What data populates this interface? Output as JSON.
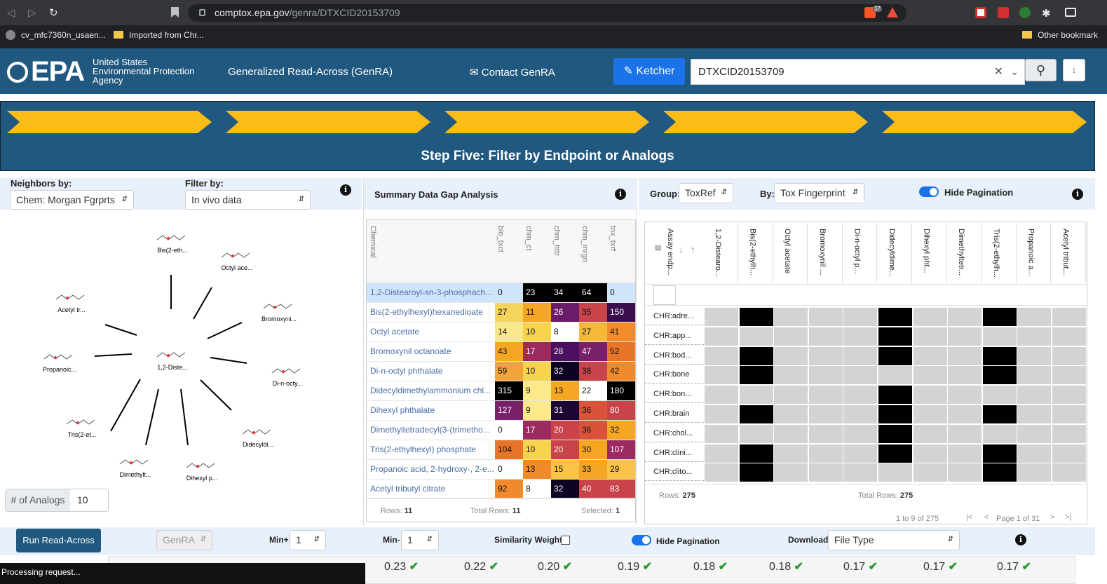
{
  "browser": {
    "url_host": "comptox.epa.gov",
    "url_path": "/genra/DTXCID20153709",
    "bookmarks": [
      "cv_mfc7360n_usaen...",
      "Imported from Chr...",
      "Other bookmark"
    ],
    "ext_badge": "37"
  },
  "header": {
    "logo": "EPA",
    "agency_line1": "United States",
    "agency_line2": "Environmental Protection",
    "agency_line3": "Agency",
    "app_title": "Generalized Read-Across (GenRA)",
    "contact": "Contact GenRA",
    "ketcher": "Ketcher",
    "search_value": "DTXCID20153709"
  },
  "steps": {
    "title": "Step Five: Filter by Endpoint or Analogs"
  },
  "left": {
    "neighbors_label": "Neighbors by:",
    "neighbors_value": "Chem: Morgan Fgrprts",
    "filter_label": "Filter by:",
    "filter_value": "In vivo data",
    "analogs_label": "# of Analogs",
    "analogs_value": "10",
    "center_label": "1,2-Diste...",
    "nodes": [
      "Bis(2-eth...",
      "Octyl ace...",
      "Bromoxyni...",
      "Di-n-octy...",
      "Didecyldi...",
      "Dihexyl p...",
      "Dimethylt...",
      "Tris(2-et...",
      "Propanoic...",
      "Acetyl tr..."
    ]
  },
  "middle": {
    "title": "Summary Data Gap Analysis",
    "col_chemical": "Chemical",
    "columns": [
      "bio_txct",
      "chm_ct",
      "chm_httr",
      "chm_mrgn",
      "tox_txrf"
    ],
    "rows": [
      {
        "name": "1,2-Distearoyl-sn-3-phosphach...",
        "vals": [
          "0",
          "23",
          "34",
          "64",
          "0"
        ],
        "colors": [
          "#cfe5fb",
          "#000000",
          "#000000",
          "#000000",
          "#cfe5fb"
        ],
        "light": [
          false,
          true,
          true,
          true,
          false
        ]
      },
      {
        "name": "Bis(2-ethylhexyl)hexanedioate",
        "vals": [
          "27",
          "11",
          "26",
          "35",
          "150"
        ],
        "colors": [
          "#f6d35a",
          "#f5a623",
          "#6a1b6a",
          "#c9434a",
          "#3a0d4d"
        ],
        "light": [
          false,
          false,
          true,
          false,
          true
        ]
      },
      {
        "name": "Octyl acetate",
        "vals": [
          "14",
          "10",
          "8",
          "27",
          "41"
        ],
        "colors": [
          "#f9e98a",
          "#f7d44e",
          "#ffffff",
          "#f5b93a",
          "#f28c2a"
        ],
        "light": [
          false,
          false,
          false,
          false,
          false
        ]
      },
      {
        "name": "Bromoxynil octanoate",
        "vals": [
          "43",
          "17",
          "28",
          "47",
          "52"
        ],
        "colors": [
          "#f5a623",
          "#9c2a5e",
          "#4b1060",
          "#7a1f6a",
          "#e8742a"
        ],
        "light": [
          false,
          true,
          true,
          true,
          false
        ]
      },
      {
        "name": "Di-n-octyl phthalate",
        "vals": [
          "59",
          "10",
          "32",
          "38",
          "42"
        ],
        "colors": [
          "#f2a33a",
          "#f7d44e",
          "#0d0221",
          "#c9434a",
          "#f08a2a"
        ],
        "light": [
          false,
          false,
          true,
          false,
          false
        ]
      },
      {
        "name": "Didecyldimethylammonium chl...",
        "vals": [
          "315",
          "9",
          "13",
          "22",
          "180"
        ],
        "colors": [
          "#000000",
          "#fbe98a",
          "#f5a623",
          "#ffffff",
          "#000000"
        ],
        "light": [
          true,
          false,
          false,
          false,
          true
        ]
      },
      {
        "name": "Dihexyl phthalate",
        "vals": [
          "127",
          "9",
          "31",
          "36",
          "80"
        ],
        "colors": [
          "#7a1f6a",
          "#fbe98a",
          "#1a0533",
          "#d9533a",
          "#c9434a"
        ],
        "light": [
          true,
          false,
          true,
          false,
          true
        ]
      },
      {
        "name": "Dimethyltetradecyl(3-(trimetho...",
        "vals": [
          "0",
          "17",
          "20",
          "36",
          "32"
        ],
        "colors": [
          "#ffffff",
          "#9c2a5e",
          "#c9434a",
          "#d9533a",
          "#f5a623"
        ],
        "light": [
          false,
          true,
          true,
          false,
          false
        ]
      },
      {
        "name": "Tris(2-ethylhexyl) phosphate",
        "vals": [
          "104",
          "10",
          "20",
          "30",
          "107"
        ],
        "colors": [
          "#e8742a",
          "#f7d44e",
          "#c9434a",
          "#f5a623",
          "#9c2a5e"
        ],
        "light": [
          false,
          false,
          true,
          false,
          true
        ]
      },
      {
        "name": "Propanoic acid, 2-hydroxy-, 2-e...",
        "vals": [
          "0",
          "13",
          "15",
          "33",
          "29"
        ],
        "colors": [
          "#ffffff",
          "#f08a2a",
          "#f9c447",
          "#f5a623",
          "#f9c447"
        ],
        "light": [
          false,
          false,
          false,
          false,
          false
        ]
      },
      {
        "name": "Acetyl tributyl citrate",
        "vals": [
          "92",
          "8",
          "32",
          "40",
          "83"
        ],
        "colors": [
          "#f08a2a",
          "#ffffff",
          "#0d0221",
          "#c9434a",
          "#c9434a"
        ],
        "light": [
          false,
          false,
          true,
          true,
          true
        ]
      }
    ],
    "rows_label": "Rows:",
    "rows_value": "11",
    "total_label": "Total Rows:",
    "total_value": "11",
    "selected_label": "Selected:",
    "selected_value": "1"
  },
  "right": {
    "group_label": "Group:",
    "group_value": "ToxRef",
    "by_label": "By:",
    "by_value": "Tox Fingerprint",
    "hide_pagination": "Hide Pagination",
    "assay_header": "Assay endp...",
    "columns": [
      "1,2-Distearo...",
      "Bis(2-ethylh...",
      "Octyl acetate",
      "Bromoxynil ...",
      "Di-n-octyl p...",
      "Didecyldime...",
      "Dihexyl pht...",
      "Dimethyltetr...",
      "Tris(2-ethylh...",
      "Propanoic a...",
      "Acetyl tribut..."
    ],
    "rows": [
      {
        "label": "CHR:adre...",
        "black": [
          1,
          5,
          8
        ]
      },
      {
        "label": "CHR:app...",
        "black": [
          5
        ]
      },
      {
        "label": "CHR:bod...",
        "black": [
          1,
          5,
          8
        ]
      },
      {
        "label": "CHR:bone",
        "black": [
          1,
          8
        ]
      },
      {
        "label": "CHR:bon...",
        "black": [
          5
        ]
      },
      {
        "label": "CHR:brain",
        "black": [
          1,
          5,
          8
        ]
      },
      {
        "label": "CHR:chol...",
        "black": [
          5
        ]
      },
      {
        "label": "CHR:clini...",
        "black": [
          1,
          5,
          8
        ]
      },
      {
        "label": "CHR:clito...",
        "black": [
          1,
          8
        ]
      }
    ],
    "rows_label": "Rows:",
    "rows_value": "275",
    "total_label": "Total Rows:",
    "total_value": "275",
    "range_text": "1 to 9 of 275",
    "page_text": "Page 1 of 31"
  },
  "bottom": {
    "run": "Run Read-Across",
    "genra": "GenRA",
    "min_plus_label": "Min+",
    "min_plus_value": "1",
    "min_minus_label": "Min-",
    "min_minus_value": "1",
    "sim_weight": "Similarity Weight:",
    "hide_pagination": "Hide Pagination",
    "download": "Download:",
    "file_type": "File Type",
    "similarities": [
      "0.23",
      "0.22",
      "0.20",
      "0.19",
      "0.18",
      "0.18",
      "0.17",
      "0.17",
      "0.17"
    ],
    "processing": "Processing request..."
  },
  "colors": {
    "epa_blue": "#21587f",
    "arrow_yellow": "#fbbc18",
    "link": "#4a6fa5"
  }
}
